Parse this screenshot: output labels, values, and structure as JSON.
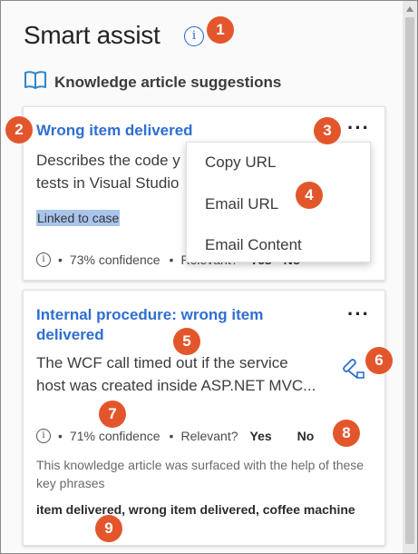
{
  "panel": {
    "title": "Smart assist",
    "info_glyph": "i",
    "section_label": "Knowledge article suggestions"
  },
  "cards": [
    {
      "title": "Wrong item delivered",
      "more_glyph": "···",
      "description": [
        "Describes the code y",
        "tests in Visual Studio"
      ],
      "linked_label": "Linked to case",
      "confidence": "73% confidence",
      "relevant_label": "Relevant?",
      "yes_label": "Yes",
      "no_label": "No"
    },
    {
      "title_lines": [
        "Internal procedure: wrong item",
        "delivered"
      ],
      "more_glyph": "···",
      "description": [
        "The WCF call timed out if the service",
        "host was created inside ASP.NET MVC..."
      ],
      "confidence": "71% confidence",
      "relevant_label": "Relevant?",
      "yes_label": "Yes",
      "no_label": "No",
      "surfaced_note": "This knowledge article was surfaced with the help of these key phrases",
      "key_phrases": "item delivered, wrong item delivered, coffee machine"
    }
  ],
  "context_menu": {
    "items": [
      "Copy URL",
      "Email URL",
      "Email Content"
    ]
  },
  "callouts": [
    "1",
    "2",
    "3",
    "4",
    "5",
    "6",
    "7",
    "8",
    "9"
  ],
  "icons": {
    "info": "info-icon",
    "book": "book-icon",
    "more": "more-options-icon",
    "link": "link-to-case-icon"
  },
  "colors": {
    "accent": "#2f6fd0",
    "callout": "#e3562c",
    "highlight": "#a9c5ec"
  }
}
